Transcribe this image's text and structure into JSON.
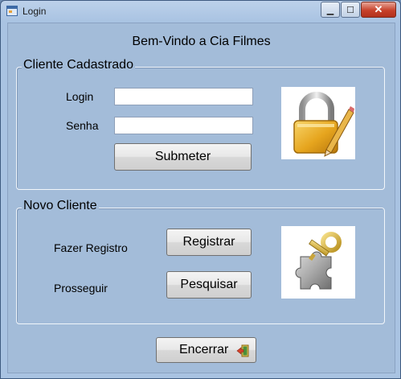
{
  "window": {
    "title": "Login",
    "minimize_glyph": "▁",
    "maximize_glyph": "☐",
    "close_glyph": "✕"
  },
  "heading": "Bem-Vindo a Cia Filmes",
  "cliente_cadastrado": {
    "legend": "Cliente Cadastrado",
    "login_label": "Login",
    "login_value": "",
    "senha_label": "Senha",
    "senha_value": "",
    "submit_label": "Submeter",
    "image_icon": "padlock-pencil-icon"
  },
  "novo_cliente": {
    "legend": "Novo Cliente",
    "registro_label": "Fazer Registro",
    "registrar_button": "Registrar",
    "prosseguir_label": "Prosseguir",
    "pesquisar_button": "Pesquisar",
    "image_icon": "puzzle-key-icon"
  },
  "exit_button": {
    "label": "Encerrar",
    "icon": "exit-door-icon"
  },
  "colors": {
    "form_background": "#a3bcd9",
    "group_border": "#f2f6fb",
    "close_button": "#c7412b"
  }
}
